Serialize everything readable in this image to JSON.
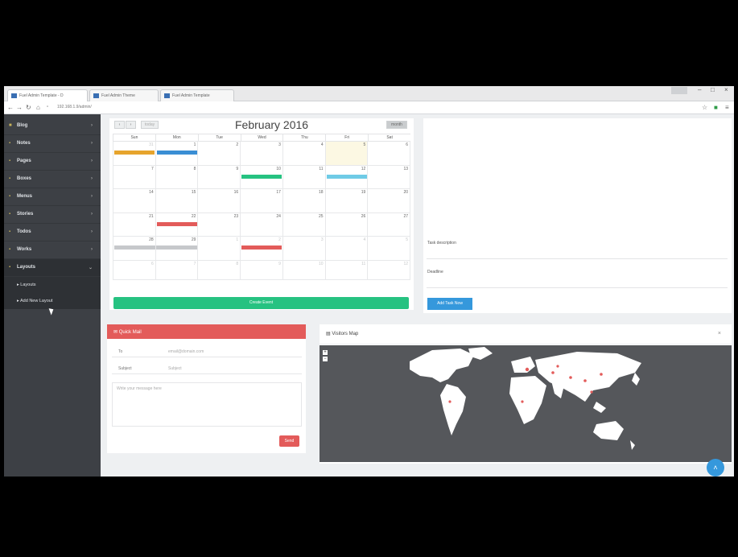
{
  "browser": {
    "tabs": [
      {
        "label": "Fuel Admin Template - D"
      },
      {
        "label": "Fuel Admin Theme"
      },
      {
        "label": "Fuel Admin Template"
      }
    ],
    "url": "192.168.1.9/admin/"
  },
  "sidebar": {
    "items": [
      {
        "label": "Blog"
      },
      {
        "label": "Notes"
      },
      {
        "label": "Pages"
      },
      {
        "label": "Boxes"
      },
      {
        "label": "Menus"
      },
      {
        "label": "Stories"
      },
      {
        "label": "Todos"
      },
      {
        "label": "Works"
      },
      {
        "label": "Layouts"
      }
    ],
    "subitems": [
      {
        "label": "Layouts"
      },
      {
        "label": "Add New Layout"
      }
    ]
  },
  "calendar": {
    "title": "February 2016",
    "buttons": {
      "prev": "‹",
      "next": "›",
      "today": "today",
      "view": "month"
    },
    "days_of_week": [
      "Sun",
      "Mon",
      "Tue",
      "Wed",
      "Thu",
      "Fri",
      "Sat"
    ],
    "weeks": [
      [
        "31",
        "1",
        "2",
        "3",
        "4",
        "5",
        "6"
      ],
      [
        "7",
        "8",
        "9",
        "10",
        "11",
        "12",
        "13"
      ],
      [
        "14",
        "15",
        "16",
        "17",
        "18",
        "19",
        "20"
      ],
      [
        "21",
        "22",
        "23",
        "24",
        "25",
        "26",
        "27"
      ],
      [
        "28",
        "29",
        "1",
        "2",
        "3",
        "4",
        "5"
      ],
      [
        "6",
        "7",
        "8",
        "9",
        "10",
        "11",
        "12"
      ]
    ],
    "add_button": "Create Event",
    "event_colors": [
      "#e6a42d",
      "#3a8ed4",
      "#26c281",
      "#6fcbe6",
      "#e35b5a",
      "#c6c8cb"
    ]
  },
  "tasks": {
    "description_label": "Task description",
    "deadline_label": "Deadline",
    "add_button": "Add Task Now"
  },
  "mail": {
    "title": "Quick Mail",
    "to_label": "To",
    "to_placeholder": "email@domain.com",
    "subject_label": "Subject",
    "subject_placeholder": "Subject",
    "message_placeholder": "Write your message here",
    "send_button": "Send"
  },
  "map": {
    "title": "Visitors Map",
    "close": "×",
    "zoom_in": "+",
    "zoom_out": "−"
  },
  "colors": {
    "sidebar": "#3d4045",
    "green": "#26c281",
    "blue": "#3598dc",
    "red": "#e35b5a",
    "map_bg": "#55575b"
  }
}
